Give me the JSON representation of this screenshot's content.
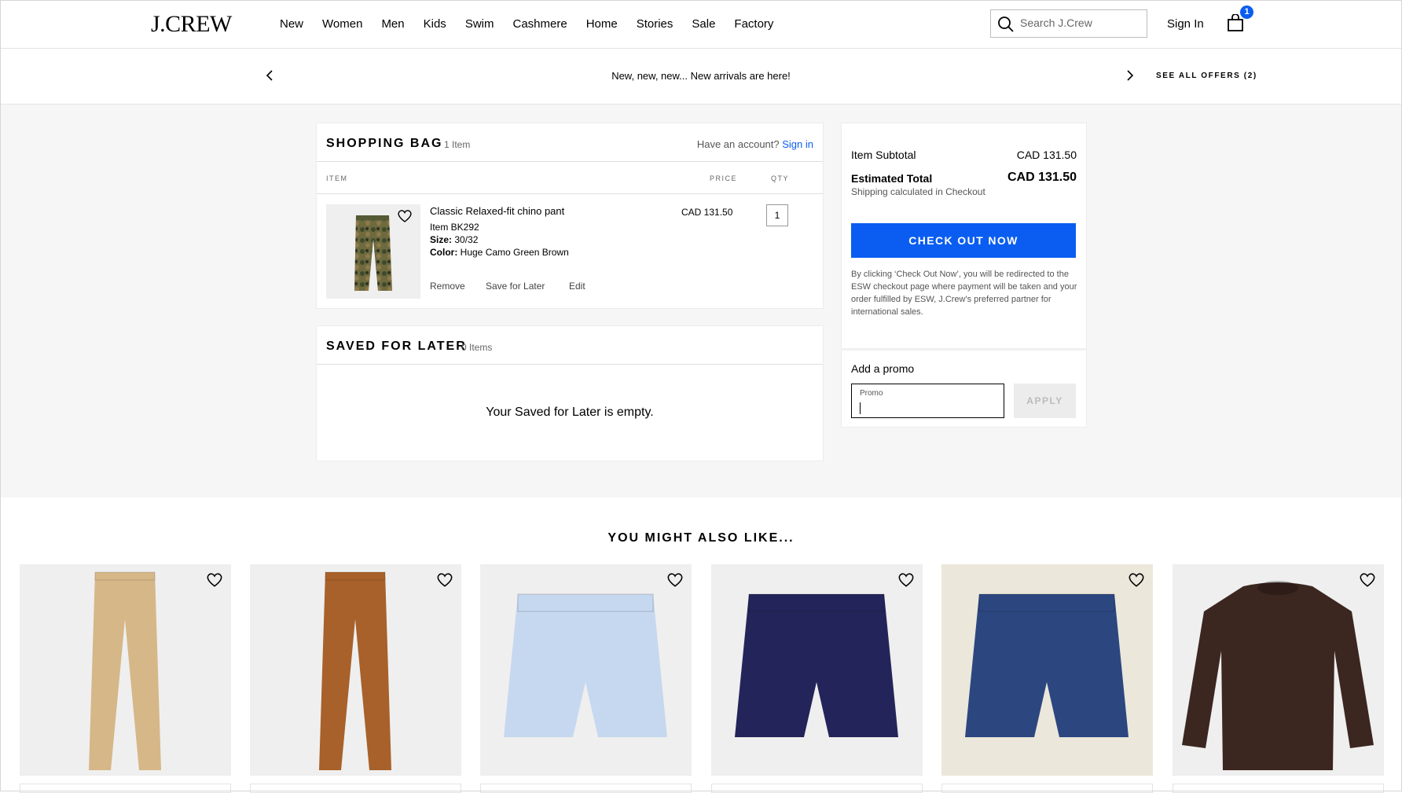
{
  "header": {
    "logo": "J.CREW",
    "nav": [
      "New",
      "Women",
      "Men",
      "Kids",
      "Swim",
      "Cashmere",
      "Home",
      "Stories",
      "Sale",
      "Factory"
    ],
    "search_placeholder": "Search J.Crew",
    "sign_in": "Sign In",
    "bag_count": "1"
  },
  "promo_strip": {
    "message": "New, new, new... New arrivals are here!",
    "see_all": "SEE ALL OFFERS (2)"
  },
  "shopping_bag": {
    "title": "SHOPPING BAG",
    "count": "1 Item",
    "have_account": "Have an account?",
    "sign_in_link": "Sign in",
    "columns": {
      "item": "ITEM",
      "price": "PRICE",
      "qty": "QTY"
    },
    "item": {
      "name": "Classic Relaxed-fit chino pant",
      "item_no": "Item BK292",
      "size_label": "Size:",
      "size": "30/32",
      "color_label": "Color:",
      "color": "Huge Camo Green Brown",
      "price": "CAD 131.50",
      "qty": "1",
      "actions": {
        "remove": "Remove",
        "save": "Save for Later",
        "edit": "Edit"
      }
    }
  },
  "saved_for_later": {
    "title": "SAVED FOR LATER",
    "count": "0 Items",
    "empty_message": "Your Saved for Later is empty."
  },
  "summary": {
    "subtotal_label": "Item Subtotal",
    "subtotal_value": "CAD 131.50",
    "total_label": "Estimated Total",
    "total_value": "CAD 131.50",
    "shipping_note": "Shipping calculated in Checkout",
    "checkout_button": "CHECK OUT NOW",
    "disclaimer": "By clicking ‘Check Out Now’, you will be redirected to the ESW checkout page where payment will be taken and your order fulfilled by ESW, J.Crew's preferred partner for international sales.",
    "accent_color": "#0a5df0"
  },
  "promo": {
    "title": "Add a promo",
    "field_label": "Promo",
    "apply_button": "APPLY"
  },
  "recommendations": {
    "title": "YOU MIGHT ALSO LIKE...",
    "items": [
      {
        "type": "pants",
        "color": "#d6b788",
        "bg": "#efefef"
      },
      {
        "type": "pants",
        "color": "#a8612a",
        "bg": "#efefef"
      },
      {
        "type": "shorts",
        "color": "#c6d8ef",
        "bg": "#efefef"
      },
      {
        "type": "shorts",
        "color": "#23255a",
        "bg": "#efefef"
      },
      {
        "type": "shorts",
        "color": "#2c4780",
        "bg": "#ece7db"
      },
      {
        "type": "sweater",
        "color": "#3c2620",
        "bg": "#efefef"
      }
    ]
  }
}
